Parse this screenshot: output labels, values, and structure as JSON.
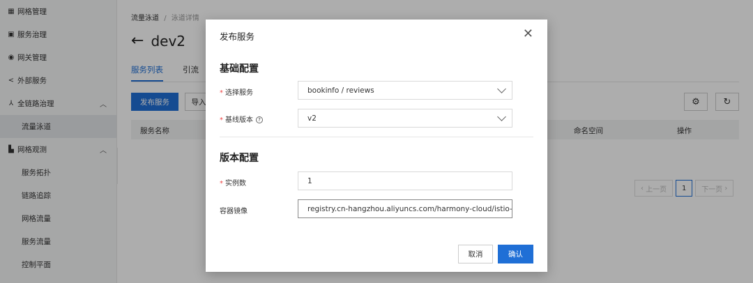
{
  "sidebar": {
    "items": [
      {
        "label": "网格管理",
        "icon": "grid-icon"
      },
      {
        "label": "服务治理",
        "icon": "service-icon"
      },
      {
        "label": "网关管理",
        "icon": "gateway-icon"
      },
      {
        "label": "外部服务",
        "icon": "share-icon"
      },
      {
        "label": "全链路治理",
        "icon": "trace-icon"
      },
      {
        "label": "流量泳道"
      },
      {
        "label": "网格观测",
        "icon": "chart-icon"
      },
      {
        "label": "服务拓扑"
      },
      {
        "label": "链路追踪"
      },
      {
        "label": "网格流量"
      },
      {
        "label": "服务流量"
      },
      {
        "label": "控制平面"
      }
    ]
  },
  "main": {
    "breadcrumb": [
      "流量泳道",
      "泳道详情"
    ],
    "title": "dev2",
    "tabs": [
      "服务列表",
      "引流"
    ],
    "publish_button": "发布服务",
    "import_button": "导入",
    "table_headers": [
      "服务名称",
      "命名空间",
      "操作"
    ],
    "pager": {
      "prev": "上一页",
      "page": "1",
      "next": "下一页"
    }
  },
  "modal": {
    "title": "发布服务",
    "section_basic": "基础配置",
    "section_version": "版本配置",
    "fields": {
      "service": {
        "label": "选择服务",
        "value": "bookinfo / reviews"
      },
      "baseline": {
        "label": "基线版本",
        "value": "v2"
      },
      "instances": {
        "label": "实例数",
        "value": "1"
      },
      "image": {
        "label": "容器镜像",
        "value": "registry.cn-hangzhou.aliyuncs.com/harmony-cloud/istio-exa"
      }
    },
    "cancel": "取消",
    "confirm": "确认"
  },
  "colors": {
    "primary": "#1f6fd6",
    "required": "#e44444"
  }
}
